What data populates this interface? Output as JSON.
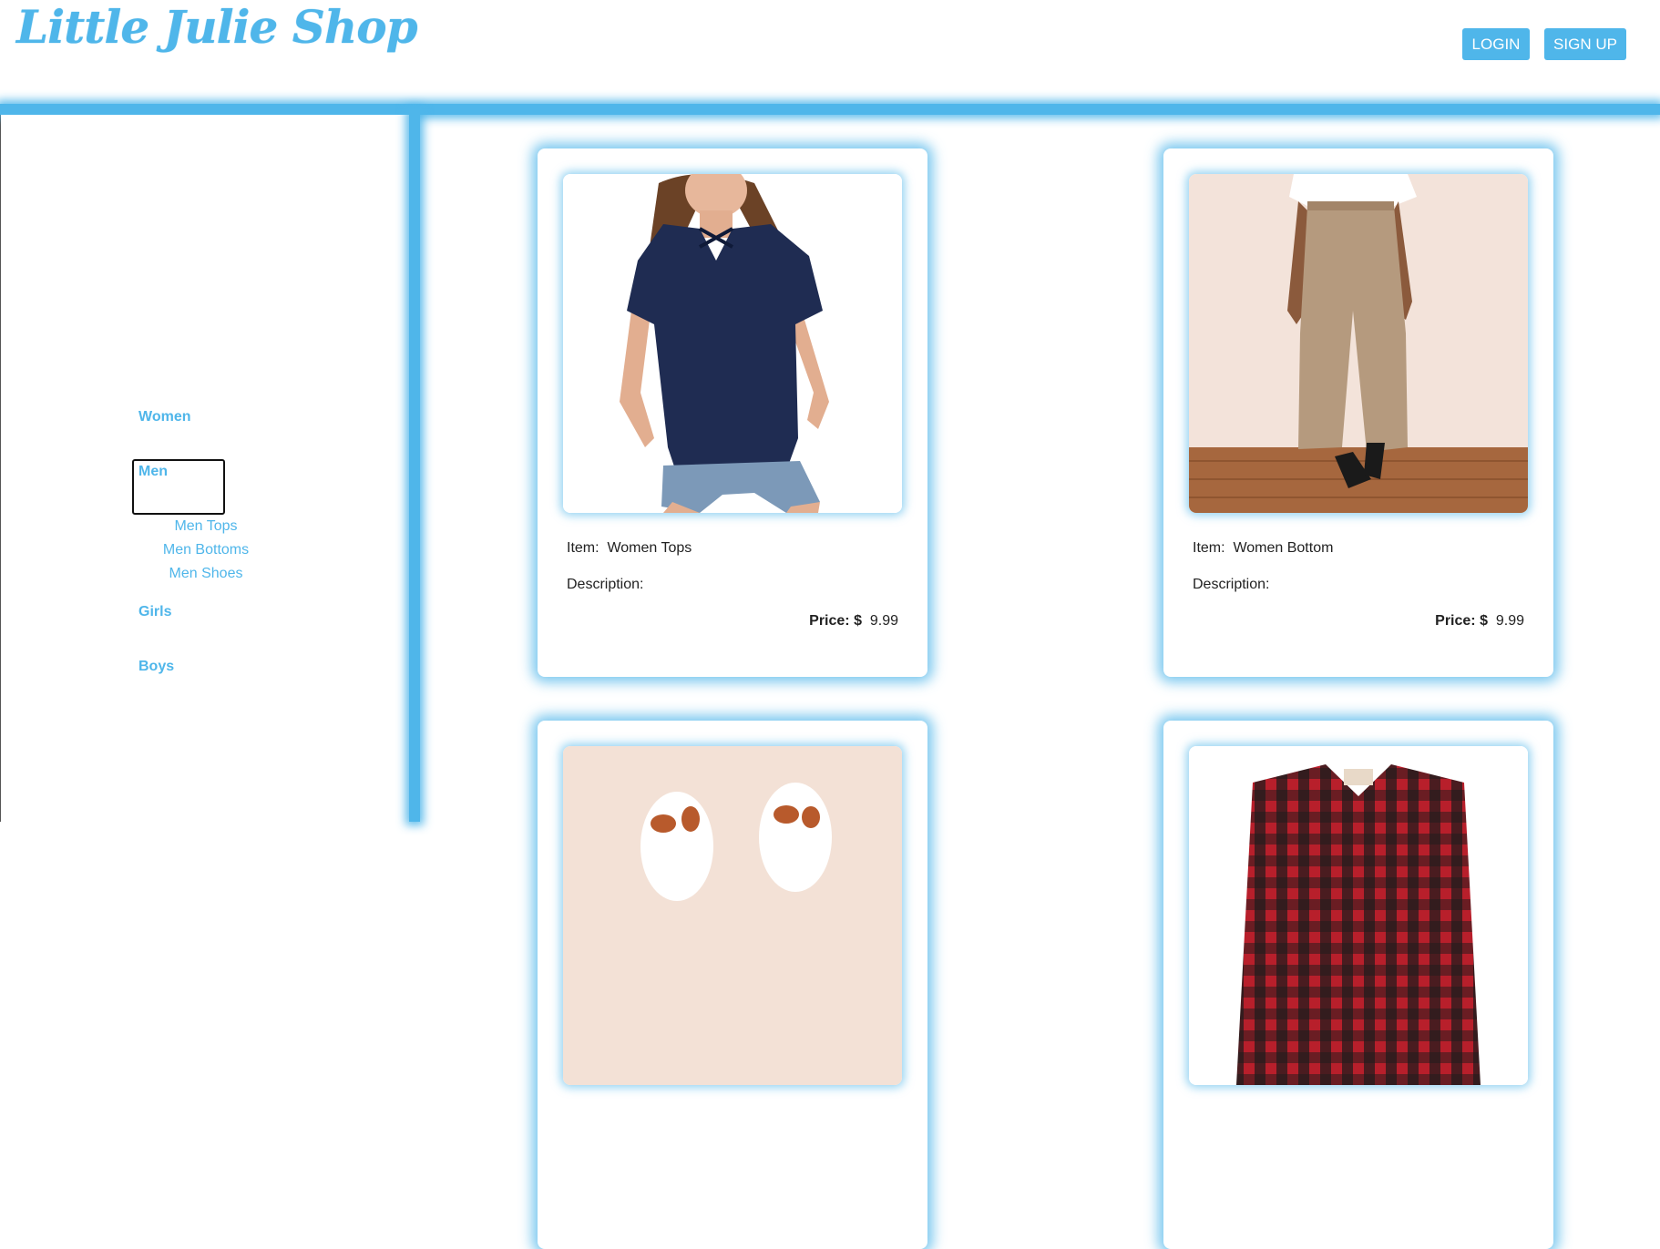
{
  "header": {
    "logo": "Little Julie Shop",
    "login_label": "LOGIN",
    "signup_label": "SIGN UP"
  },
  "sidebar": {
    "categories": [
      {
        "label": "Women"
      },
      {
        "label": "Men",
        "expanded": true,
        "children": [
          {
            "label": "Men Tops"
          },
          {
            "label": "Men Bottoms"
          },
          {
            "label": "Men Shoes"
          }
        ]
      },
      {
        "label": "Girls"
      },
      {
        "label": "Boys"
      }
    ]
  },
  "products": [
    {
      "item_label": "Item:",
      "item": "Women Tops",
      "description_label": "Description:",
      "description": "",
      "price_label": "Price:",
      "currency": "$",
      "price": "9.99",
      "image": "navy-tshirt-photo"
    },
    {
      "item_label": "Item:",
      "item": "Women Bottom",
      "description_label": "Description:",
      "description": "",
      "price_label": "Price:",
      "currency": "$",
      "price": "9.99",
      "image": "tan-culottes-photo"
    },
    {
      "image": "slippers-photo"
    },
    {
      "image": "plaid-shirt-photo"
    }
  ],
  "colors": {
    "accent": "#4fb6ea",
    "text": "#222222",
    "background": "#ffffff"
  }
}
